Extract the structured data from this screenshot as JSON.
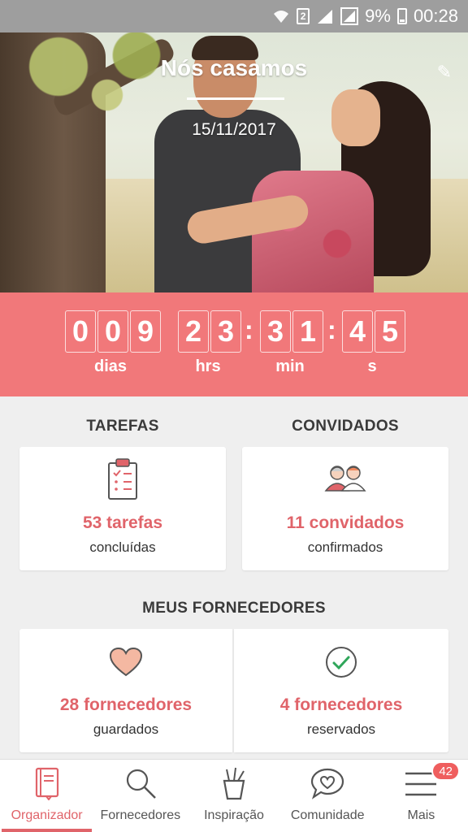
{
  "status_bar": {
    "battery": "9%",
    "time": "00:28",
    "sim": "2"
  },
  "hero": {
    "title": "Nós casamos",
    "date": "15/11/2017"
  },
  "countdown": {
    "days": [
      "0",
      "0",
      "9"
    ],
    "hours": [
      "2",
      "3"
    ],
    "minutes": [
      "3",
      "1"
    ],
    "seconds": [
      "4",
      "5"
    ],
    "sep": ":",
    "labels": {
      "days": "dias",
      "hours": "hrs",
      "minutes": "min",
      "seconds": "s"
    }
  },
  "tasks": {
    "title": "TAREFAS",
    "count": "53 tarefas",
    "sub": "concluídas"
  },
  "guests": {
    "title": "CONVIDADOS",
    "count": "11 convidados",
    "sub": "confirmados"
  },
  "vendors": {
    "title": "MEUS FORNECEDORES",
    "saved": {
      "count": "28 fornecedores",
      "sub": "guardados"
    },
    "booked": {
      "count": "4 fornecedores",
      "sub": "reservados"
    }
  },
  "nav": {
    "items": [
      {
        "label": "Organizador"
      },
      {
        "label": "Fornecedores"
      },
      {
        "label": "Inspiração"
      },
      {
        "label": "Comunidade"
      },
      {
        "label": "Mais",
        "badge": "42"
      }
    ]
  },
  "colors": {
    "accent": "#f1787a",
    "accent_text": "#e0646a",
    "status_bar": "#9e9e9e"
  }
}
